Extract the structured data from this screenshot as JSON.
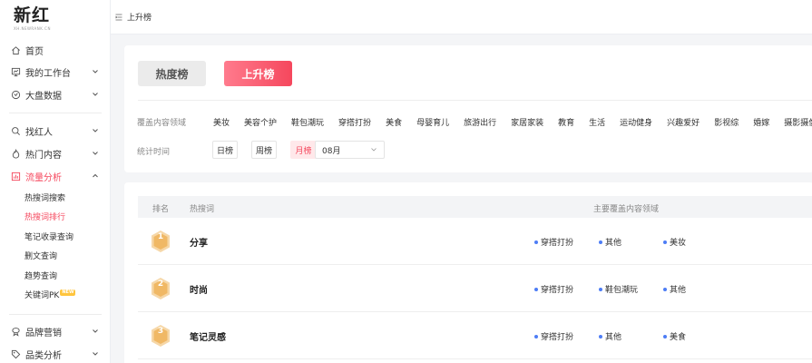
{
  "logo": {
    "main": "新红",
    "sub": "XH.NEWRANK.CN"
  },
  "sidebar": {
    "groups": [
      {
        "label": "首页",
        "icon": "home-icon"
      },
      {
        "label": "我的工作台",
        "icon": "workbench-icon"
      },
      {
        "label": "大盘数据",
        "icon": "dashboard-icon"
      },
      {
        "label": "找红人",
        "icon": "search-icon"
      },
      {
        "label": "热门内容",
        "icon": "flame-icon"
      },
      {
        "label": "流量分析",
        "icon": "chart-icon"
      },
      {
        "label": "品牌营销",
        "icon": "brand-icon"
      },
      {
        "label": "品类分析",
        "icon": "tag-icon"
      }
    ],
    "sub_items": [
      "热搜词搜索",
      "热搜词排行",
      "笔记收录查询",
      "删文查询",
      "趋势查询",
      "关键词PK"
    ],
    "new_badge": "NEW"
  },
  "topbar": {
    "breadcrumb": "上升榜"
  },
  "filters": {
    "tab_heat": "热度榜",
    "tab_rise": "上升榜",
    "category_label": "覆盖内容领域",
    "categories": [
      "美妆",
      "美容个护",
      "鞋包潮玩",
      "穿搭打扮",
      "美食",
      "母婴育儿",
      "旅游出行",
      "家居家装",
      "教育",
      "生活",
      "运动健身",
      "兴趣爱好",
      "影视综",
      "婚嫁",
      "摄影摄像"
    ],
    "time_label": "统计时间",
    "time_options": [
      "日榜",
      "周榜",
      "月榜"
    ],
    "month_value": "08月"
  },
  "table": {
    "headers": {
      "rank": "排名",
      "term": "热搜词",
      "domain": "主要覆盖内容领域"
    },
    "rows": [
      {
        "rank": "1",
        "term": "分享",
        "tags": [
          "穿搭打扮",
          "其他",
          "美妆"
        ]
      },
      {
        "rank": "2",
        "term": "时尚",
        "tags": [
          "穿搭打扮",
          "鞋包潮玩",
          "其他"
        ]
      },
      {
        "rank": "3",
        "term": "笔记灵感",
        "tags": [
          "穿搭打扮",
          "其他",
          "美食"
        ]
      }
    ]
  },
  "colors": {
    "accent": "#f5475d",
    "medal": "#f3c27a",
    "tag_dot": "#4d7df5"
  }
}
